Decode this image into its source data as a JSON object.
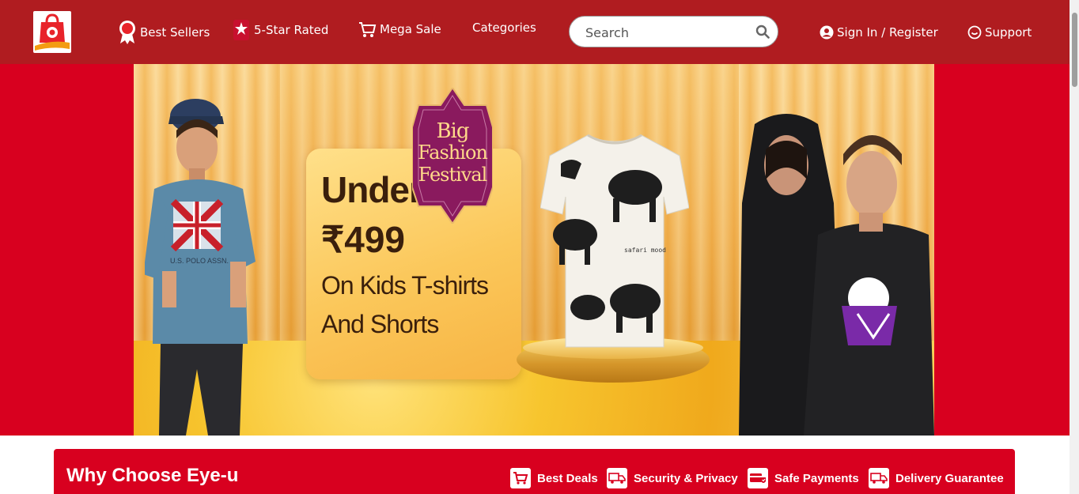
{
  "header": {
    "logo_letter": "e",
    "nav": {
      "best_sellers": "Best Sellers",
      "five_star": "5-Star Rated",
      "mega_sale": "Mega Sale",
      "categories": "Categories",
      "sign_in": "Sign In / Register",
      "support": "Support"
    },
    "search": {
      "placeholder": "Search"
    },
    "icons": [
      "best-seller-ribbon-icon",
      "star-rated-icon",
      "sale-cart-icon",
      "search-icon",
      "user-icon",
      "support-chat-icon"
    ]
  },
  "banner": {
    "badge_line1": "Big",
    "badge_line2": "Fashion",
    "badge_line3": "Festival",
    "under": "Under",
    "price": "₹499",
    "line1": "On Kids T-shirts",
    "line2": "And Shorts",
    "tshirt_brand": "U.S. POLO ASSN.",
    "kids_tee_text": "safari mood"
  },
  "why_choose": {
    "title": "Why Choose Eye-u",
    "features": [
      {
        "label": "Best Deals",
        "icon": "cart-icon"
      },
      {
        "label": "Security & Privacy",
        "icon": "secure-truck-icon"
      },
      {
        "label": "Safe Payments",
        "icon": "payment-card-icon"
      },
      {
        "label": "Delivery Guarantee",
        "icon": "delivery-truck-icon"
      }
    ]
  },
  "colors": {
    "header_bg": "#b01c20",
    "hero_bg": "#d8001f",
    "banner_gold": "#f3b648",
    "badge_purple": "#8a1a5e"
  }
}
